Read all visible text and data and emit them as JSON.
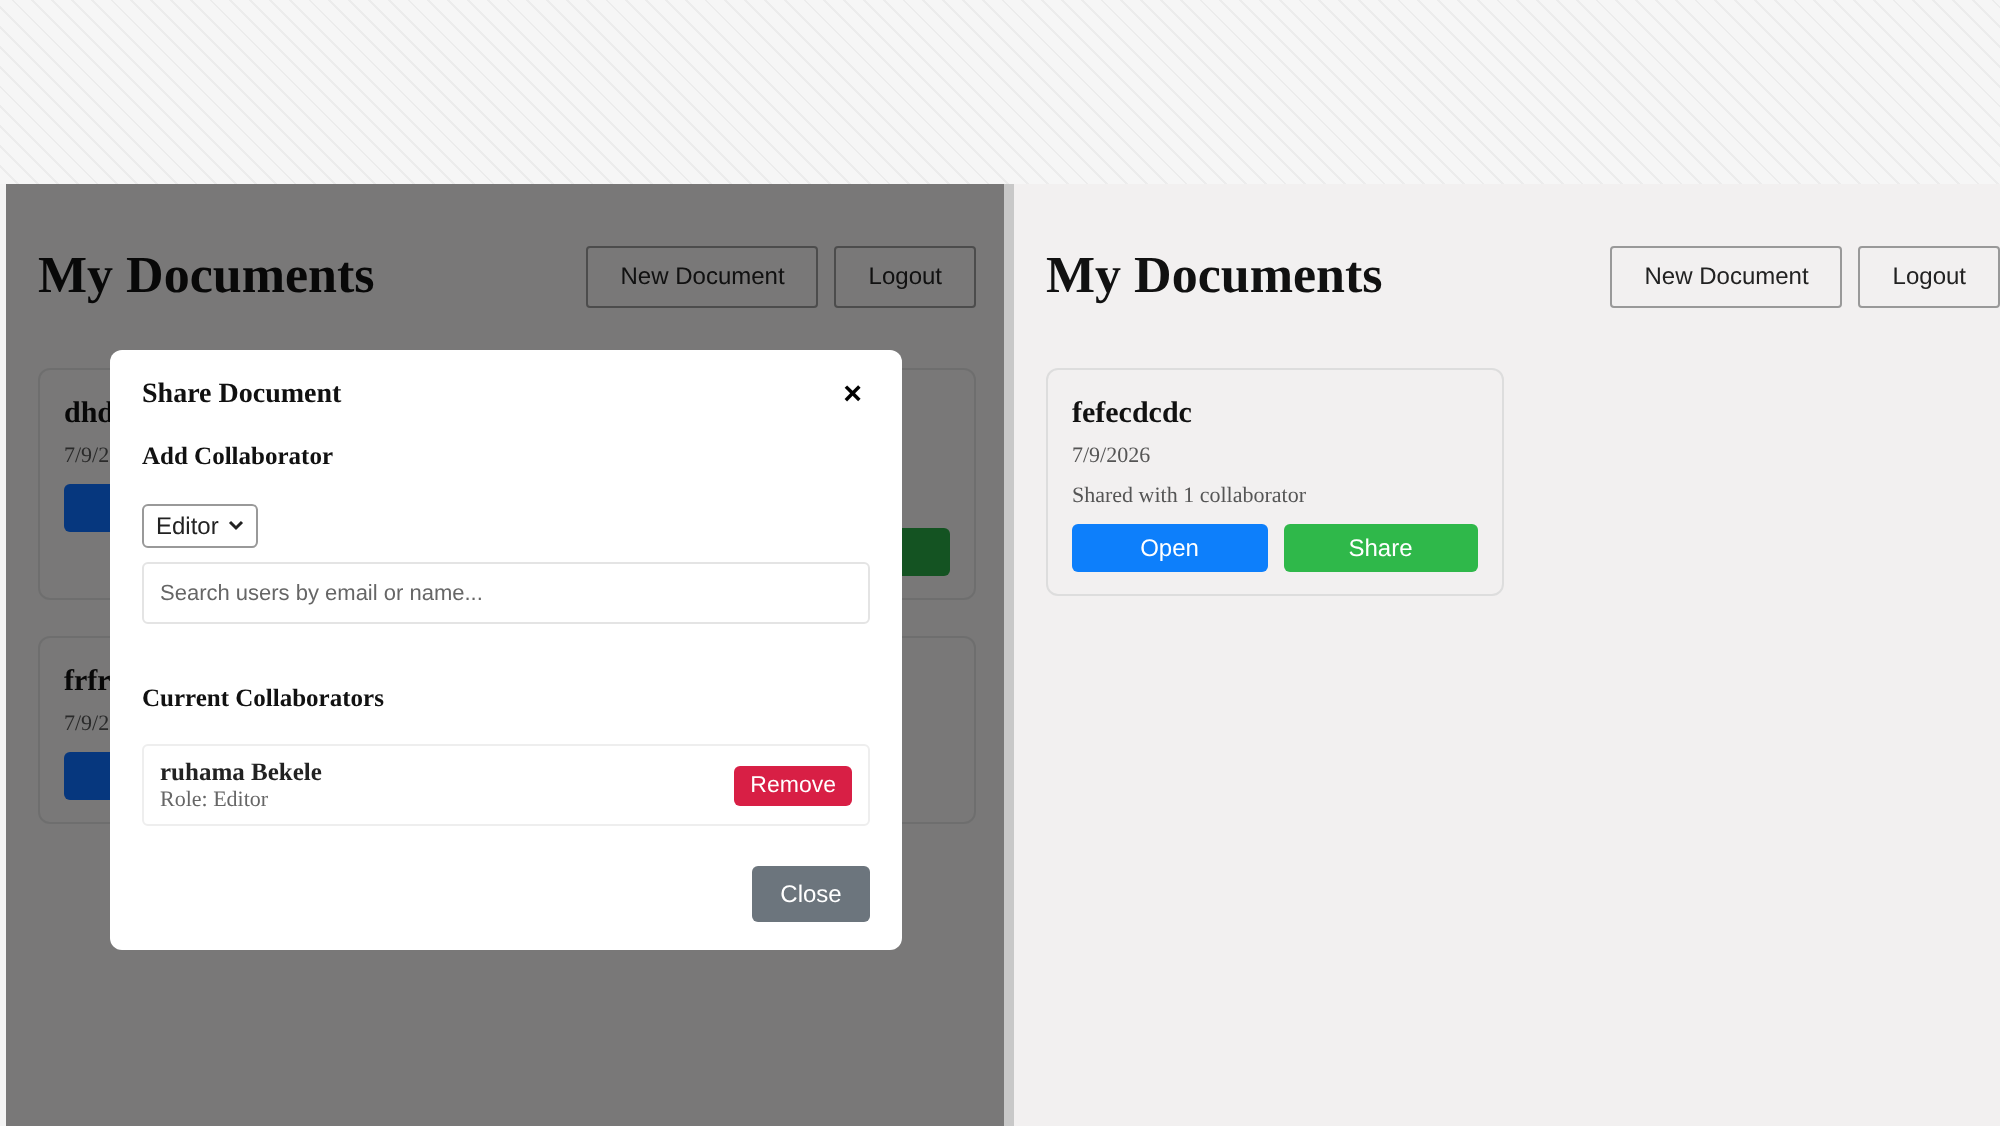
{
  "left_window": {
    "title": "My Documents",
    "header_buttons": [
      "New Document",
      "Logout"
    ],
    "documents": [
      {
        "title": "dhd",
        "date": "7/9/2"
      },
      {
        "title": "frfr",
        "date": "7/9/2"
      }
    ],
    "dialog": {
      "title": "Share Document",
      "close_icon": "×",
      "add_heading": "Add Collaborator",
      "role_select": "Editor",
      "search": {
        "placeholder": "Search users by email or name..."
      },
      "current_heading": "Current Collaborators",
      "collaborators": [
        {
          "name": "ruhama Bekele",
          "role": "Role: Editor",
          "action": "Remove"
        }
      ],
      "close_button": "Close"
    }
  },
  "right_window": {
    "title": "My Documents",
    "header_buttons": [
      "New Document",
      "Logout"
    ],
    "documents": [
      {
        "title": "fefecdcdc",
        "date": "7/9/2026",
        "shared": "Shared with 1 collaborator",
        "open": "Open",
        "share": "Share"
      }
    ]
  }
}
